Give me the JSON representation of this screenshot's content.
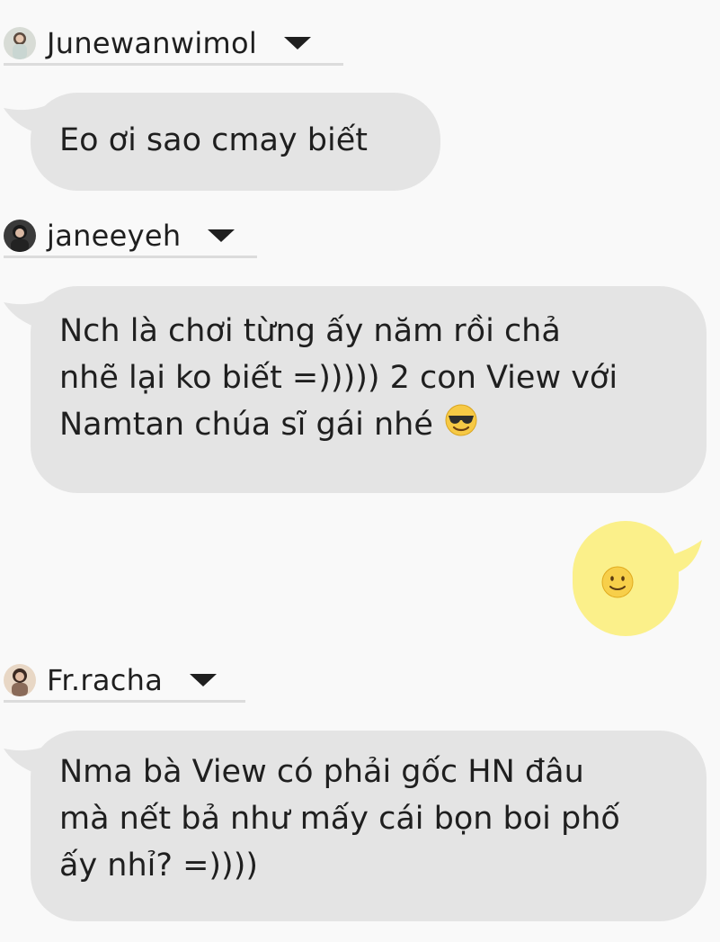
{
  "messages": [
    {
      "user": "Junewanwimol",
      "text": "Eo ơi sao cmay biết"
    },
    {
      "user": "janeeyeh",
      "lines": [
        "Nch là chơi từng ấy năm rồi chả",
        "nhẽ lại ko biết =))))) 2 con View với",
        "Namtan chúa sĩ gái nhé"
      ],
      "emoji": "smiling-face-with-sunglasses"
    },
    {
      "own_emoji": "slightly-smiling-face"
    },
    {
      "user": "Fr.racha",
      "lines": [
        "Nma bà View có phải gốc HN đâu",
        "mà nết bả như mấy cái bọn boi phố",
        "ấy nhỉ? =))))"
      ]
    }
  ],
  "colors": {
    "background": "#f9f9f9",
    "bubble_in": "#e4e4e4",
    "bubble_out": "#fbf08a",
    "divider": "#dcdcdc"
  }
}
